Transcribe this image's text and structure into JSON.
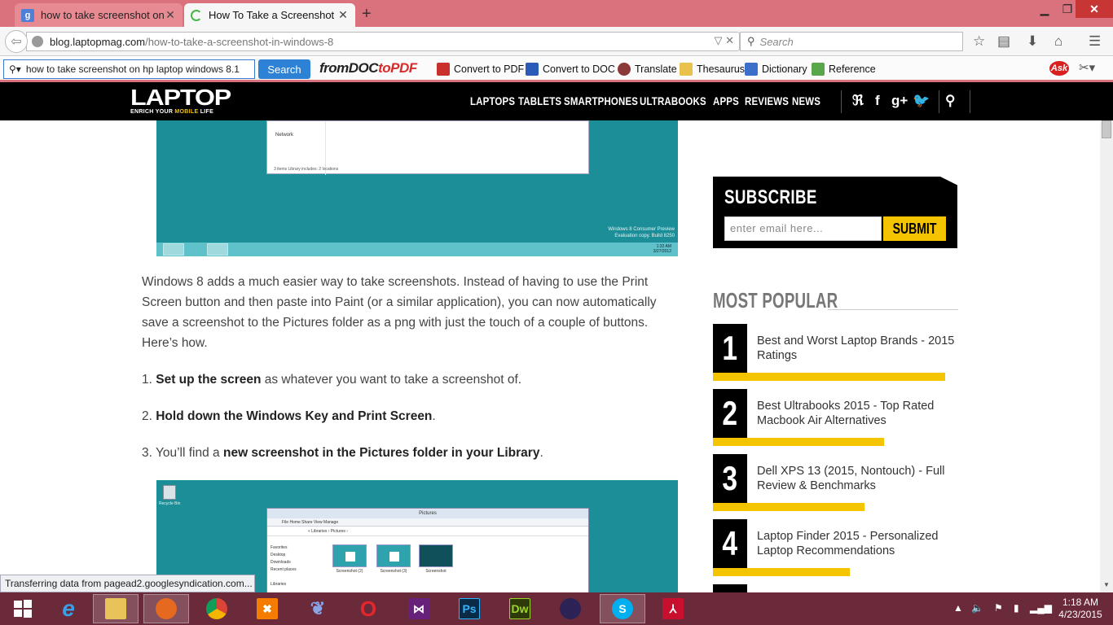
{
  "browser": {
    "tabs": [
      {
        "title": "how to take screenshot on ..."
      },
      {
        "title": "How To Take a Screenshot ..."
      }
    ],
    "url_domain": "blog.laptopmag.com",
    "url_path": "/how-to-take-a-screenshot-in-windows-8",
    "search_placeholder": "Search",
    "status_text": "Transferring data from pagead2.googlesyndication.com..."
  },
  "toolbar": {
    "query": "how to take screenshot on hp laptop windows 8.1",
    "search_label": "Search",
    "logo_prefix": "from",
    "logo_mid": "DOC",
    "logo_to": "to",
    "logo_end": "PDF",
    "links": [
      "Convert to PDF",
      "Convert to DOC",
      "Translate",
      "Thesaurus",
      "Dictionary",
      "Reference"
    ],
    "ask_label": "Ask"
  },
  "site": {
    "logo": "LAPTOP",
    "tagline_a": "ENRICH YOUR ",
    "tagline_b": "MOBILE",
    "tagline_c": " LIFE",
    "nav": [
      "LAPTOPS",
      "TABLETS",
      "SMARTPHONES",
      "ULTRABOOKS",
      "APPS",
      "REVIEWS",
      "NEWS"
    ]
  },
  "screenshot1": {
    "network": "Network",
    "status": "3 items     Library includes: 2 locations",
    "watermark_1": "Windows 8 Consumer Preview",
    "watermark_2": "Evaluation copy. Build 8250",
    "time": "1:32 AM",
    "date": "3/27/2012"
  },
  "article": {
    "intro": "Windows 8 adds a much easier way to take screenshots. Instead of having to use the Print Screen button and then paste into Paint (or a similar application), you can now automatically save a screenshot to the Pictures folder as a png with just the touch of a couple of buttons. Here’s how.",
    "step1_num": "1. ",
    "step1_bold": "Set up the screen",
    "step1_rest": " as whatever you want to take a screenshot of.",
    "step2_num": "2. ",
    "step2_bold": "Hold down the Windows Key and Print Screen",
    "step2_rest": ".",
    "step3_num": "3. You’ll find a ",
    "step3_bold": "new screenshot in the Pictures folder in your Library",
    "step3_rest": "."
  },
  "screenshot2": {
    "recycle": "Recycle Bin",
    "title": "Pictures",
    "ribbon": "File    Home    Share    View    Manage",
    "address": "« Libraries  ›  Pictures  ›",
    "nav": [
      "Favorites",
      "Desktop",
      "Downloads",
      "Recent places",
      "",
      "Libraries"
    ],
    "thumbs": [
      "Screenshot (2)",
      "Screenshot (3)",
      "Screenshot"
    ]
  },
  "sidebar": {
    "subscribe_title": "SUBSCRIBE",
    "email_placeholder": "enter email here...",
    "submit": "SUBMIT",
    "most_popular": "MOST POPULAR",
    "items": [
      {
        "num": "1",
        "title": "Best and Worst Laptop Brands - 2015 Ratings",
        "bar": 0.95
      },
      {
        "num": "2",
        "title": "Best Ultrabooks 2015 - Top Rated Macbook Air Alternatives",
        "bar": 0.7
      },
      {
        "num": "3",
        "title": "Dell XPS 13 (2015, Nontouch) - Full Review & Benchmarks",
        "bar": 0.62
      },
      {
        "num": "4",
        "title": "Laptop Finder 2015 - Personalized Laptop Recommendations",
        "bar": 0.56
      }
    ]
  },
  "taskbar": {
    "time": "1:18 AM",
    "date": "4/23/2015"
  }
}
